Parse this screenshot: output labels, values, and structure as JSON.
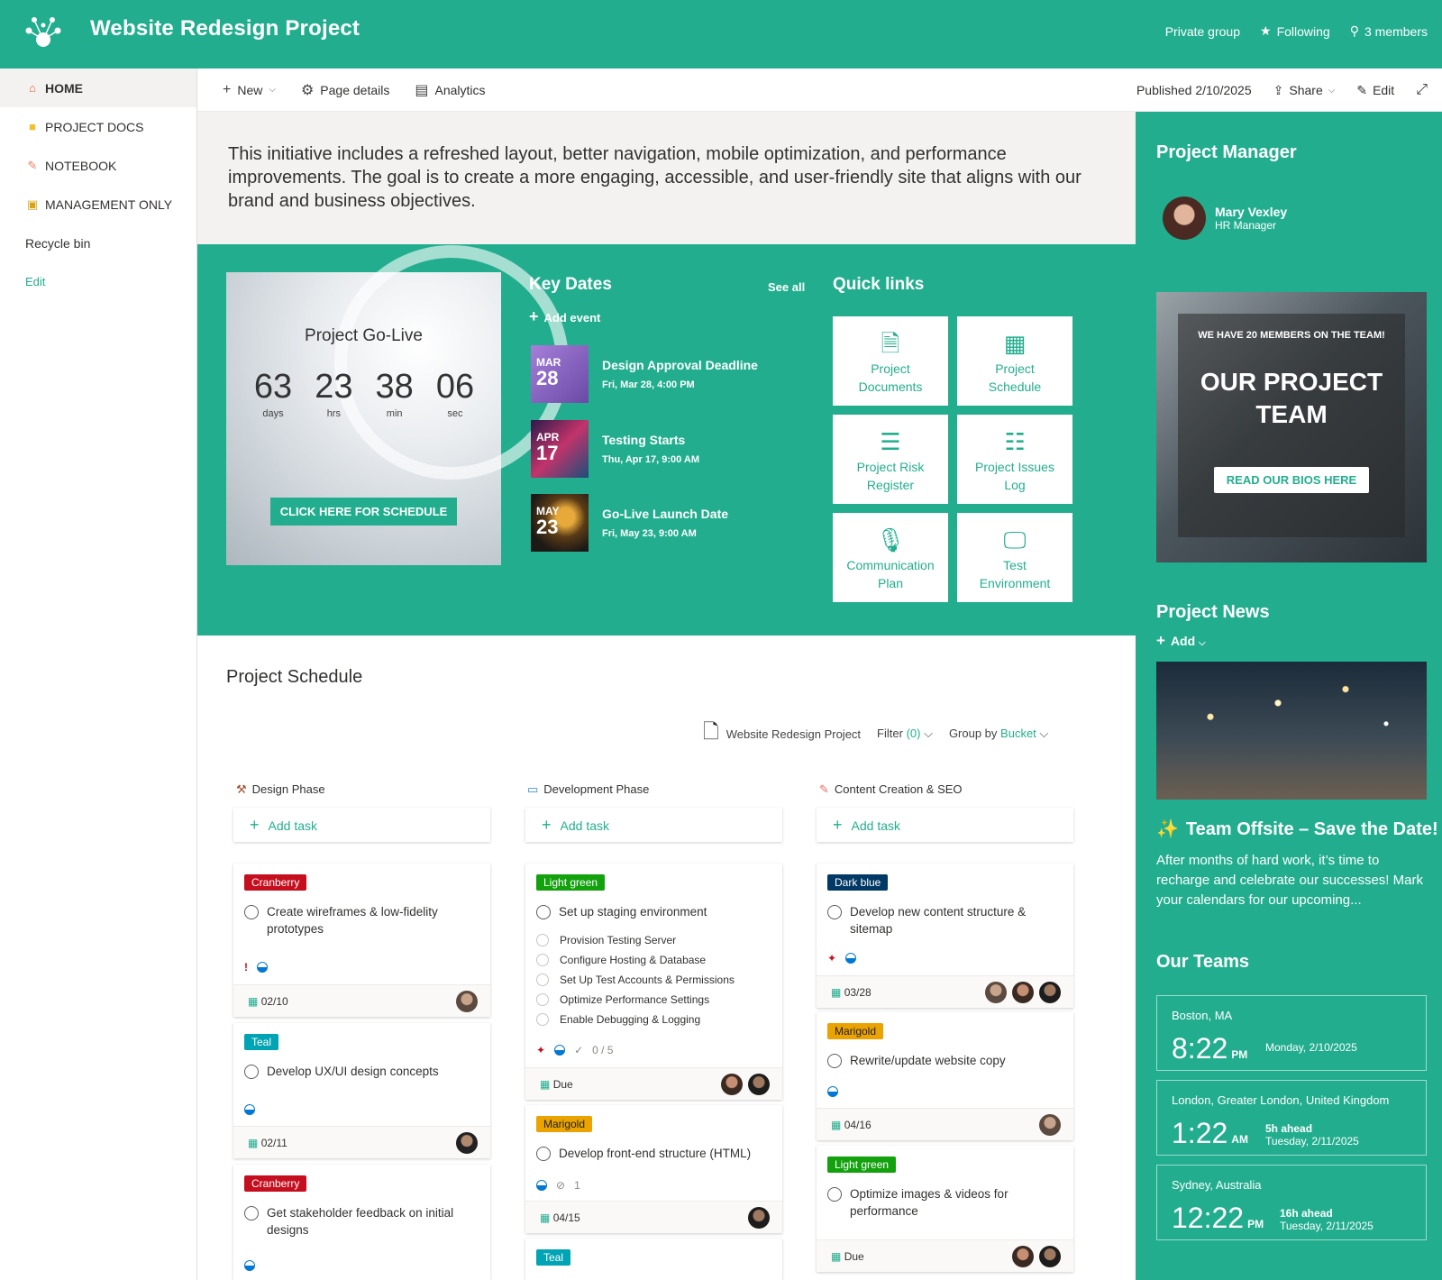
{
  "header": {
    "site_title": "Website Redesign Project",
    "privacy": "Private group",
    "following": "Following",
    "members": "3 members"
  },
  "nav": {
    "items": [
      {
        "label": "HOME",
        "icon": "home-icon"
      },
      {
        "label": "PROJECT DOCS",
        "icon": "folder-icon"
      },
      {
        "label": "NOTEBOOK",
        "icon": "notebook-icon"
      },
      {
        "label": "MANAGEMENT ONLY",
        "icon": "lock-icon"
      }
    ],
    "recycle": "Recycle bin",
    "edit": "Edit"
  },
  "commandbar": {
    "new": "New",
    "page_details": "Page details",
    "analytics": "Analytics",
    "published": "Published 2/10/2025",
    "share": "Share",
    "edit": "Edit"
  },
  "intro": "This initiative includes a refreshed layout, better navigation, mobile optimization, and performance improvements. The goal is to create a more engaging, accessible, and user-friendly site that aligns with our brand and business objectives.",
  "countdown": {
    "title": "Project Go-Live",
    "days": "63",
    "hrs": "23",
    "min": "38",
    "sec": "06",
    "days_label": "days",
    "hrs_label": "hrs",
    "min_label": "min",
    "sec_label": "sec",
    "button": "CLICK HERE FOR SCHEDULE"
  },
  "key_dates": {
    "title": "Key Dates",
    "see_all": "See all",
    "add_event": "Add event",
    "events": [
      {
        "month": "MAR",
        "day": "28",
        "title": "Design Approval Deadline",
        "when": "Fri, Mar 28, 4:00 PM"
      },
      {
        "month": "APR",
        "day": "17",
        "title": "Testing Starts",
        "when": "Thu, Apr 17, 9:00 AM"
      },
      {
        "month": "MAY",
        "day": "23",
        "title": "Go-Live Launch Date",
        "when": "Fri, May 23, 9:00 AM"
      }
    ]
  },
  "quick_links": {
    "title": "Quick links",
    "items": [
      {
        "line1": "Project",
        "line2": "Documents"
      },
      {
        "line1": "Project",
        "line2": "Schedule"
      },
      {
        "line1": "Project Risk",
        "line2": "Register"
      },
      {
        "line1": "Project Issues",
        "line2": "Log"
      },
      {
        "line1": "Communication",
        "line2": "Plan"
      },
      {
        "line1": "Test",
        "line2": "Environment"
      }
    ]
  },
  "schedule": {
    "title": "Project Schedule",
    "plan_name": "Website Redesign Project",
    "filter": "Filter",
    "filter_count": "(0)",
    "group_by": "Group by",
    "group_value": "Bucket",
    "add_task": "Add task",
    "buckets": [
      "Design Phase",
      "Development Phase",
      "Content Creation & SEO"
    ],
    "cards": {
      "d1": {
        "tag": "Cranberry",
        "title": "Create wireframes & low-fidelity prototypes",
        "date": "02/10"
      },
      "d2": {
        "tag": "Teal",
        "title": "Develop UX/UI design concepts",
        "date": "02/11"
      },
      "d3": {
        "tag": "Cranberry",
        "title": "Get stakeholder feedback on initial designs"
      },
      "v1": {
        "tag": "Light green",
        "title": "Set up staging environment",
        "subtasks": [
          "Provision Testing Server",
          "Configure Hosting & Database",
          "Set Up Test Accounts & Permissions",
          "Optimize Performance Settings",
          "Enable Debugging & Logging"
        ],
        "checklist": "0 / 5",
        "date": "Due"
      },
      "v2": {
        "tag": "Marigold",
        "title": "Develop front-end structure (HTML)",
        "attachments": "1",
        "date": "04/15"
      },
      "v3": {
        "tag": "Teal"
      },
      "c1": {
        "tag": "Dark blue",
        "title": "Develop new content structure & sitemap",
        "date": "03/28"
      },
      "c2": {
        "tag": "Marigold",
        "title": "Rewrite/update website copy",
        "date": "04/16"
      },
      "c3": {
        "tag": "Light green",
        "title": "Optimize images & videos for performance",
        "date": "Due"
      }
    }
  },
  "right_rail": {
    "pm_heading": "Project Manager",
    "pm_name": "Mary Vexley",
    "pm_role": "HR Manager",
    "team_small": "WE HAVE 20 MEMBERS ON THE TEAM!",
    "team_big1": "OUR PROJECT",
    "team_big2": "TEAM",
    "team_button": "READ OUR BIOS HERE",
    "news_heading": "Project News",
    "news_add": "Add",
    "news_title": "Team Offsite – Save the Date!",
    "news_text": "After months of hard work, it’s time to recharge and celebrate our successes! Mark your calendars for our upcoming...",
    "teams_heading": "Our Teams",
    "clocks": [
      {
        "city": "Boston, MA",
        "time": "8:22",
        "ampm": "PM",
        "offset": "",
        "date": "Monday, 2/10/2025"
      },
      {
        "city": "London, Greater London, United Kingdom",
        "time": "1:22",
        "ampm": "AM",
        "offset": "5h ahead",
        "date": "Tuesday, 2/11/2025"
      },
      {
        "city": "Sydney, Australia",
        "time": "12:22",
        "ampm": "PM",
        "offset": "16h ahead",
        "date": "Tuesday, 2/11/2025"
      }
    ]
  },
  "colors": {
    "brand": "#22ae8e",
    "cranberry": "#c50f1f",
    "teal": "#00a4b4",
    "light_green": "#13a10e",
    "marigold": "#eaa300",
    "dark_blue": "#003966"
  }
}
